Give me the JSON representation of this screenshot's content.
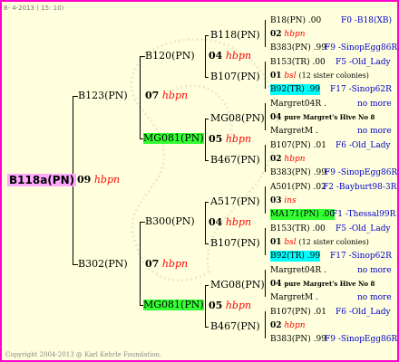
{
  "header": {
    "date": "8-  4-2013 ( 15: 10)"
  },
  "footer": {
    "copyright": "Copyright 2004-2013 @ Karl Kehrle Foundation."
  },
  "root": {
    "id": "B118a(PN)",
    "year": "09",
    "mark": "hbpn"
  },
  "gen1": [
    {
      "id": "B123(PN)",
      "year": "07",
      "mark": "hbpn"
    },
    {
      "id": "B302(PN)",
      "year": "07",
      "mark": "hbpn"
    }
  ],
  "gen2": [
    {
      "id": "B120(PN)"
    },
    {
      "id": "MG081(PN)"
    },
    {
      "id": "B300(PN)"
    },
    {
      "id": "MG081(PN)"
    }
  ],
  "gen2_years": [
    {
      "year": "04",
      "mark": "hbpn"
    },
    {
      "year": "07",
      "mark": "hbpn"
    }
  ],
  "gen3": [
    {
      "id": "B118(PN)",
      "year": "04",
      "mark": "hbpn"
    },
    {
      "id": "B107(PN)"
    },
    {
      "id": "MG08(PN)",
      "year": "05",
      "mark": "hbpn"
    },
    {
      "id": "B467(PN)"
    },
    {
      "id": "A517(PN)",
      "year": "04",
      "mark": "hbpn"
    },
    {
      "id": "B107(PN)"
    },
    {
      "id": "MG08(PN)",
      "year": "05",
      "mark": "hbpn"
    },
    {
      "id": "B467(PN)"
    }
  ],
  "gen4": [
    {
      "top": "B18(PN) .00",
      "topr": "F0 -B18(XB)",
      "year": "02",
      "mark": "hbpn",
      "bot": "B383(PN) .99",
      "botr": "F9 -SinopEgg86R"
    },
    {
      "top": "B153(TR) .00",
      "topr": "F5 -Old_Lady",
      "year": "01",
      "mark": "bsl",
      "note": "(12 sister colonies)",
      "bot": "B92(TR) .99",
      "botr": "F17 -Sinop62R"
    },
    {
      "top": "Margret04R .",
      "topr": "no more",
      "year": "04",
      "note": "pure Margret's Hive No 8",
      "bot": "MargretM .",
      "botr": "no more"
    },
    {
      "top": "B107(PN) .01",
      "topr": "F6 -Old_Lady",
      "year": "02",
      "mark": "hbpn",
      "bot": "B383(PN) .99",
      "botr": "F9 -SinopEgg86R"
    },
    {
      "top": "A501(PN) .02",
      "topr": "F2 -Bayburt98-3R",
      "year": "03",
      "mark": "ins",
      "bot": "MA171(PN) .00",
      "botr": "F1 -Thessal99R"
    },
    {
      "top": "B153(TR) .00",
      "topr": "F5 -Old_Lady",
      "year": "01",
      "mark": "bsl",
      "note": "(12 sister colonies)",
      "bot": "B92(TR) .99",
      "botr": "F17 -Sinop62R"
    },
    {
      "top": "Margret04R .",
      "topr": "no more",
      "year": "04",
      "note": "pure Margret's Hive No 8",
      "bot": "MargretM .",
      "botr": "no more"
    },
    {
      "top": "B107(PN) .01",
      "topr": "F6 -Old_Lady",
      "year": "02",
      "mark": "hbpn",
      "bot": "B383(PN) .99",
      "botr": "F9 -SinopEgg86R"
    }
  ]
}
